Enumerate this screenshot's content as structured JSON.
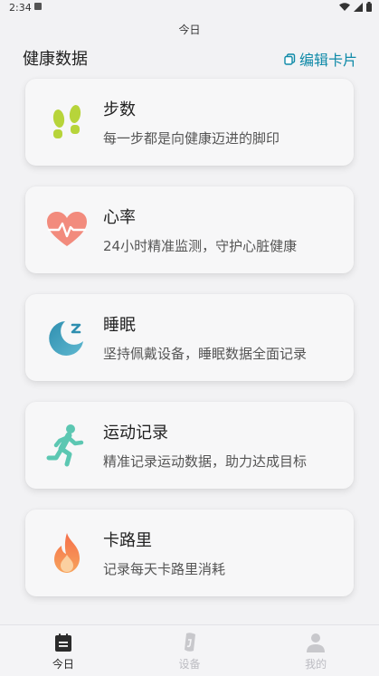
{
  "status": {
    "time": "2:34"
  },
  "app": {
    "title": "今日"
  },
  "section": {
    "title": "健康数据",
    "edit_label": "编辑卡片"
  },
  "cards": [
    {
      "title": "步数",
      "desc": "每一步都是向健康迈进的脚印",
      "icon": "footprints-icon"
    },
    {
      "title": "心率",
      "desc": "24小时精准监测，守护心脏健康",
      "icon": "heart-rate-icon"
    },
    {
      "title": "睡眠",
      "desc": "坚持佩戴设备，睡眠数据全面记录",
      "icon": "moon-sleep-icon"
    },
    {
      "title": "运动记录",
      "desc": "精准记录运动数据，助力达成目标",
      "icon": "running-icon"
    },
    {
      "title": "卡路里",
      "desc": "记录每天卡路里消耗",
      "icon": "flame-icon"
    }
  ],
  "nav": [
    {
      "label": "今日",
      "active": true
    },
    {
      "label": "设备",
      "active": false
    },
    {
      "label": "我的",
      "active": false
    }
  ],
  "colors": {
    "accent": "#0f8aa8",
    "background": "#f2f2f4"
  }
}
